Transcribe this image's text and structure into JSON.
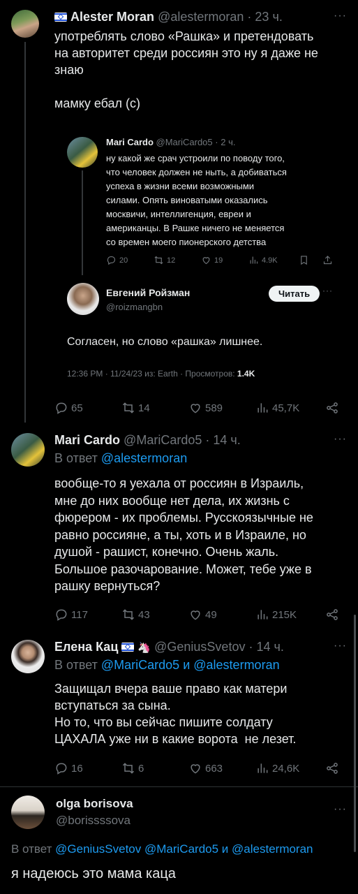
{
  "tweet1": {
    "display_name": "Alester Moran",
    "handle": "@alestermoran",
    "time": "· 23 ч.",
    "text": "употреблять слово «Рашка» и претендовать\nна авторитет среди россиян это ну я даже не\nзнаю\n\nмамку ебал (с)",
    "more": "···",
    "stats": {
      "replies": "65",
      "retweets": "14",
      "likes": "589",
      "views": "45,7K"
    }
  },
  "quote": {
    "display_name": "Mari Cardo",
    "handle": "@MariCardo5",
    "time": "· 2 ч.",
    "text": "ну какой же срач устроили по поводу того,\nчто человек должен не ныть, а добиваться\nуспеха в жизни всеми возможными\nсилами. Опять виноватыми оказались\nмосквичи, интеллигенция, евреи и\nамериканцы. В Рашке ничего не меняется\nсо времен моего пионерского детства",
    "stats": {
      "replies": "20",
      "retweets": "12",
      "likes": "19",
      "views": "4.9K"
    }
  },
  "inner_quote": {
    "display_name": "Евгений Ройзман",
    "handle": "@roizmangbn",
    "read_label": "Читать",
    "more": "···",
    "text": "Согласен, но слово «рашка» лишнее.",
    "meta": "12:36 PM · 11/24/23 из: Earth · Просмотров: ",
    "views": "1.4K"
  },
  "tweet2": {
    "display_name": "Mari Cardo",
    "handle": "@MariCardo5",
    "time": "· 14 ч.",
    "reply_prefix": "В ответ ",
    "reply_to": "@alestermoran",
    "more": "···",
    "text": "вообще-то я уехала от россиян в Израиль,\nмне до них вообще нет дела, их жизнь с\nфюрером - их проблемы. Русскоязычные не\nравно россияне, а ты, хоть и в Израиле, но\nдушой - рашист, конечно. Очень жаль.\nБольшое разочарование. Может, тебе уже в\nрашку вернуться?",
    "stats": {
      "replies": "117",
      "retweets": "43",
      "likes": "49",
      "views": "215K"
    }
  },
  "tweet3": {
    "display_name": "Елена Кац",
    "emoji": "🦄",
    "handle": "@GeniusSvetov",
    "time": "· 14 ч.",
    "reply_prefix": "В ответ ",
    "reply_to_1": "@MariCardo5",
    "reply_and": " и ",
    "reply_to_2": "@alestermoran",
    "more": "···",
    "text": "Защищал вчера ваше право как матери\nвступаться за сына.\nНо то, что вы сейчас пишите солдату\nЦАХАЛА уже ни в какие ворота  не лезет.",
    "stats": {
      "replies": "16",
      "retweets": "6",
      "likes": "663",
      "views": "24,6K"
    }
  },
  "tweet4": {
    "display_name": "olga borisova",
    "handle": "@borissssova",
    "more": "···",
    "reply_prefix": "В ответ ",
    "reply_to_1": "@GeniusSvetov",
    "reply_to_2": "@MariCardo5",
    "reply_and": " и ",
    "reply_to_3": "@alestermoran",
    "text": "я надеюсь это мама каца"
  },
  "colors": {
    "link": "#1d9bf0",
    "muted": "#71767b",
    "text": "#e7e9ea",
    "background": "#000000"
  }
}
